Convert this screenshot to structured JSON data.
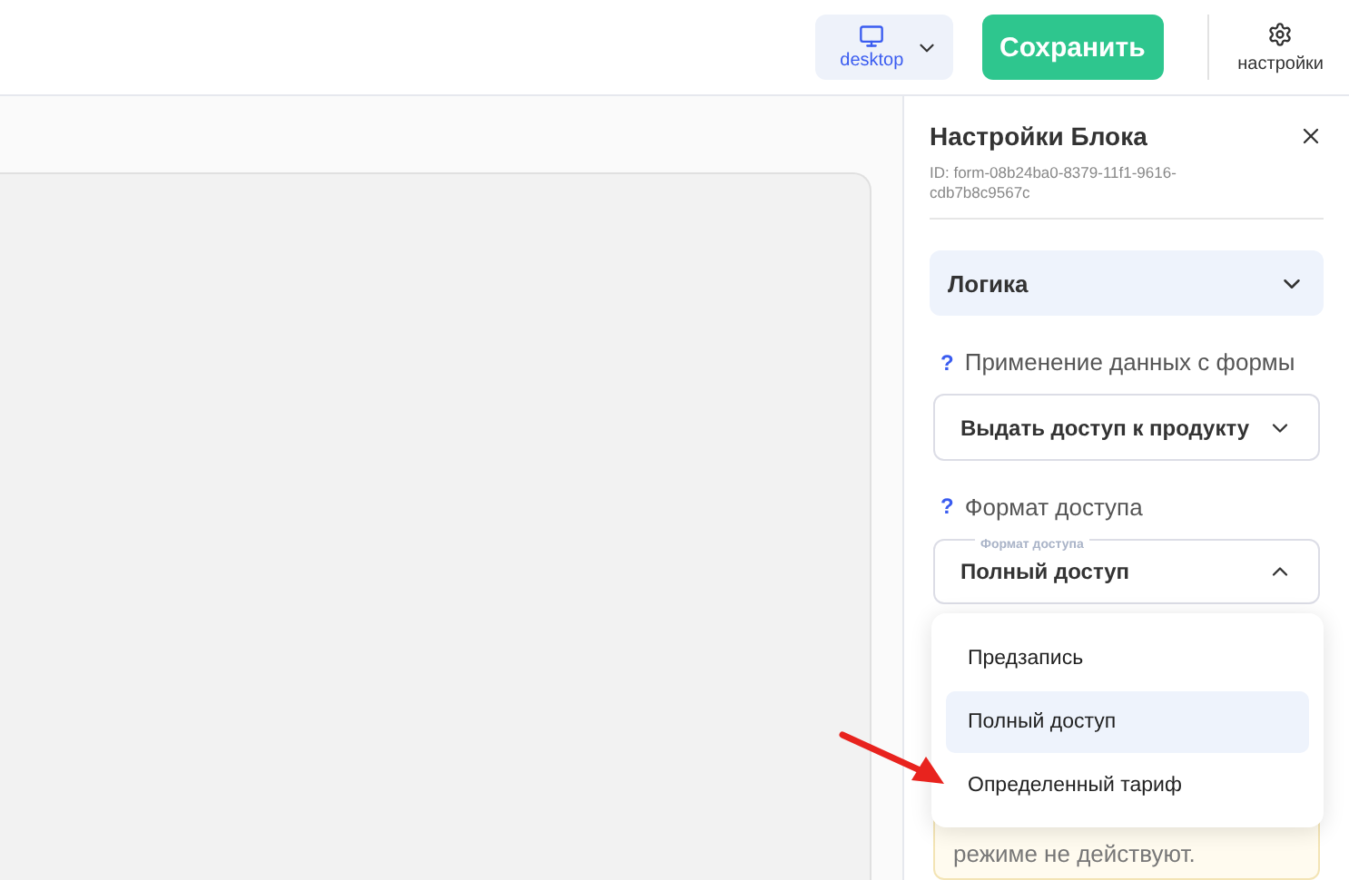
{
  "toolbar": {
    "device": {
      "label": "desktop"
    },
    "save_button": "Сохранить",
    "settings": {
      "label": "настройки"
    }
  },
  "panel": {
    "title": "Настройки Блока",
    "id_text": "ID: form-08b24ba0-8379-11f1-9616-cdb7b8c9567c",
    "section": {
      "title": "Логика",
      "expanded": true
    },
    "fields": [
      {
        "help": "?",
        "label": "Применение данных с формы",
        "value": "Выдать доступ к продукту",
        "open": false
      },
      {
        "help": "?",
        "label": "Формат доступа",
        "legend": "Формат доступа",
        "value": "Полный доступ",
        "open": true
      }
    ],
    "options": [
      {
        "label": "Предзапись",
        "selected": false
      },
      {
        "label": "Полный доступ",
        "selected": true
      },
      {
        "label": "Определенный тариф",
        "selected": false
      }
    ],
    "notice": "режиме не действуют."
  }
}
